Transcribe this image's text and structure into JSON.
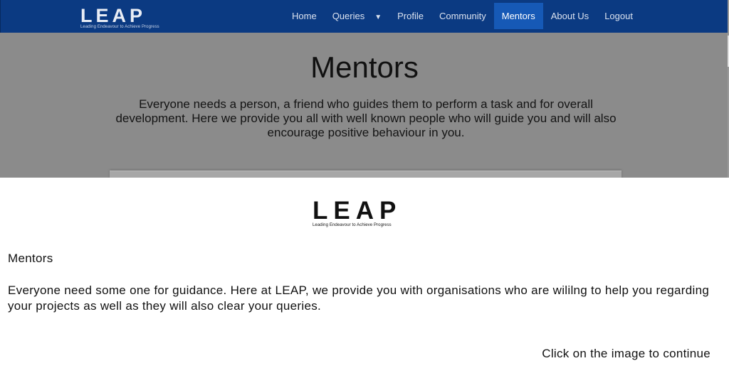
{
  "nav": {
    "logo_text": "LEAP",
    "logo_tagline": "Leading Endeavour to Achieve Progress",
    "items": [
      {
        "label": "Home"
      },
      {
        "label": "Queries"
      },
      {
        "label": "Profile"
      },
      {
        "label": "Community"
      },
      {
        "label": "Mentors"
      },
      {
        "label": "About Us"
      },
      {
        "label": "Logout"
      }
    ],
    "active_item": "Mentors",
    "caret_glyph": "▼"
  },
  "page": {
    "heading": "Mentors",
    "intro": "Everyone needs a person, a friend who guides them to perform a task and for overall development. Here we provide you all with well known people who will guide you and will also encourage positive behaviour in you."
  },
  "overlay": {
    "logo_text": "LEAP",
    "logo_tagline": "Leading Endeavour to Achieve Progress",
    "title": "Mentors",
    "description": "Everyone need some one for guidance. Here at LEAP, we provide you with organisations who are wililng to help you regarding your projects as well as they will also clear your queries.",
    "continue_label": "Click on the image to continue"
  },
  "colors": {
    "navbar": "#0b3a82",
    "nav_active": "#1659b6",
    "dimmed_page": "#8b8b8b",
    "overlay_bg": "#ffffff"
  }
}
